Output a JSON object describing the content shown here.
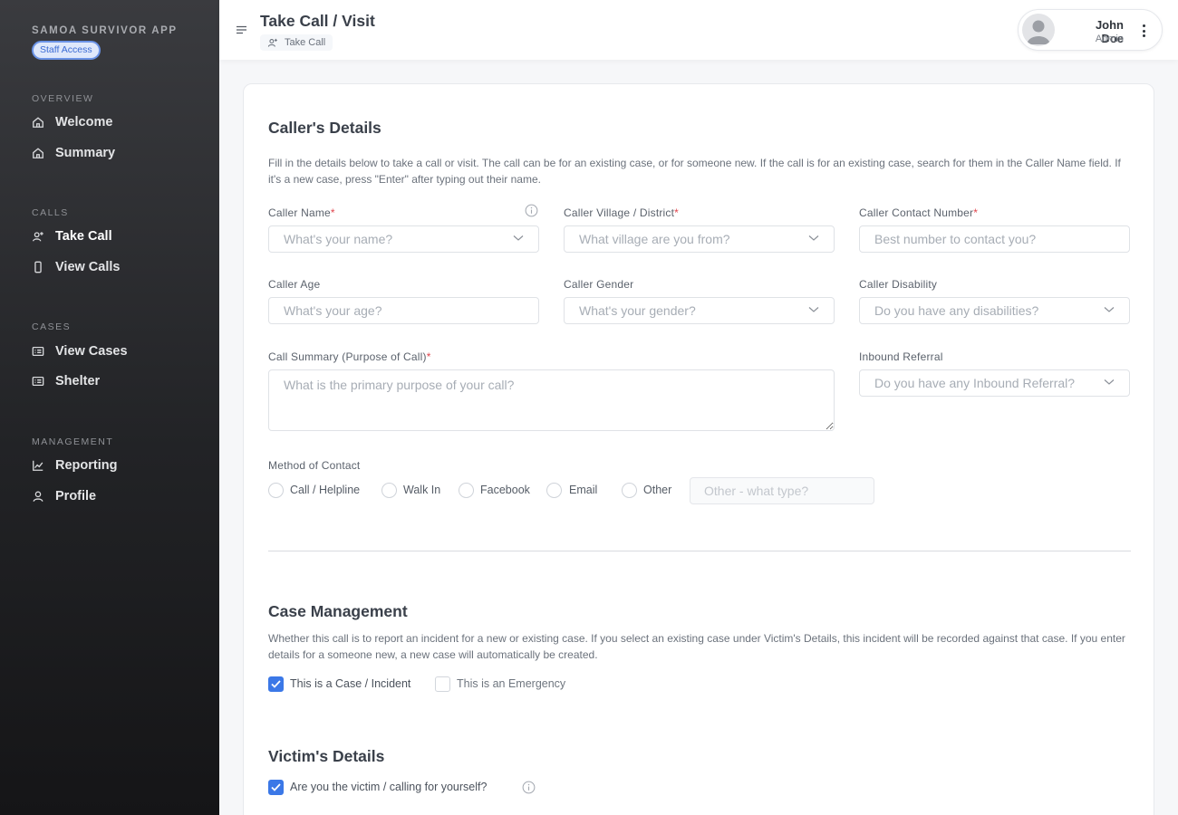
{
  "sidebar": {
    "app_title": "SAMOA SURVIVOR APP",
    "badge": "Staff Access",
    "sections": [
      {
        "title": "OVERVIEW",
        "items": [
          {
            "label": "Welcome",
            "icon": "home-icon"
          },
          {
            "label": "Summary",
            "icon": "home-icon"
          }
        ]
      },
      {
        "title": "CALLS",
        "items": [
          {
            "label": "Take Call",
            "icon": "add-user-icon",
            "active": true
          },
          {
            "label": "View Calls",
            "icon": "phone-icon"
          }
        ]
      },
      {
        "title": "CASES",
        "items": [
          {
            "label": "View Cases",
            "icon": "list-card-icon"
          },
          {
            "label": "Shelter",
            "icon": "list-card-icon"
          }
        ]
      },
      {
        "title": "MANAGEMENT",
        "items": [
          {
            "label": "Reporting",
            "icon": "line-chart-icon"
          },
          {
            "label": "Profile",
            "icon": "user-icon"
          }
        ]
      }
    ]
  },
  "header": {
    "title": "Take Call / Visit",
    "breadcrumb": "Take Call",
    "user": {
      "name": "John Doe",
      "role": "Admin"
    }
  },
  "callers_details": {
    "title": "Caller's Details",
    "description": "Fill in the details below to take a call or visit. The call can be for an existing case, or for someone new. If the call is for an existing case, search for them in the Caller Name field. If it's a new case, press \"Enter\" after typing out their name.",
    "fields": {
      "caller_name": {
        "label": "Caller Name",
        "required": "*",
        "placeholder": "What's your name?"
      },
      "caller_village": {
        "label": "Caller Village / District",
        "required": "*",
        "placeholder": "What village are you from?"
      },
      "caller_contact": {
        "label": "Caller Contact Number",
        "required": "*",
        "placeholder": "Best number to contact you?"
      },
      "caller_age": {
        "label": "Caller Age",
        "placeholder": "What's your age?"
      },
      "caller_gender": {
        "label": "Caller Gender",
        "placeholder": "What's your gender?"
      },
      "caller_disability": {
        "label": "Caller Disability",
        "placeholder": "Do you have any disabilities?"
      },
      "call_summary": {
        "label": "Call Summary (Purpose of Call)",
        "required": "*",
        "placeholder": "What is the primary purpose of your call?"
      },
      "inbound_referral": {
        "label": "Inbound Referral",
        "placeholder": "Do you have any Inbound Referral?"
      }
    },
    "method_of_contact": {
      "label": "Method of Contact",
      "options": [
        "Call / Helpline",
        "Walk In",
        "Facebook",
        "Email",
        "Other"
      ],
      "other_placeholder": "Other - what type?"
    }
  },
  "case_management": {
    "title": "Case Management",
    "description": "Whether this call is to report an incident for a new or existing case. If you select an existing case under Victim's Details, this incident will be recorded against that case. If you enter details for a someone new, a new case will automatically be created.",
    "checkboxes": [
      {
        "label": "This is a Case / Incident",
        "checked": true
      },
      {
        "label": "This is an Emergency",
        "checked": false
      }
    ]
  },
  "victims_details": {
    "title": "Victim's Details",
    "checkbox": {
      "label": "Are you the victim / calling for yourself?",
      "checked": true
    }
  },
  "colors": {
    "accent": "#3b78e7",
    "required": "#e0464e",
    "sidebar_bg": "#222326"
  }
}
